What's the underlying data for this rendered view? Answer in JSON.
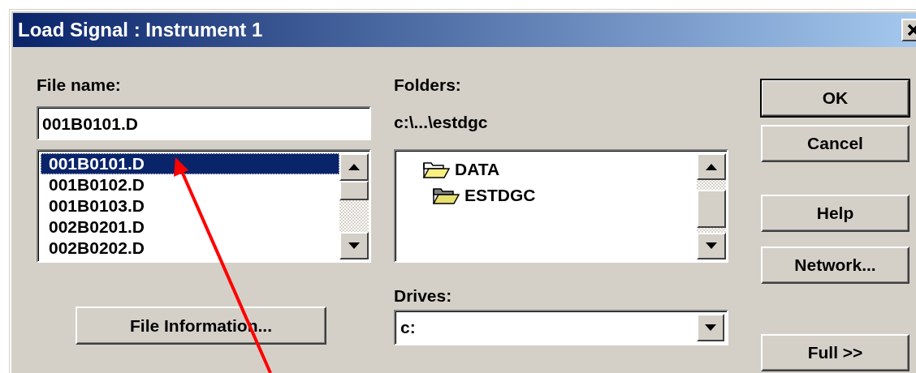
{
  "window": {
    "title": "Load Signal : Instrument 1"
  },
  "file_name": {
    "label": "File name:",
    "value": "001B0101.D"
  },
  "files": [
    {
      "name": "001B0101.D",
      "selected": true
    },
    {
      "name": "001B0102.D",
      "selected": false
    },
    {
      "name": "001B0103.D",
      "selected": false
    },
    {
      "name": "002B0201.D",
      "selected": false
    },
    {
      "name": "002B0202.D",
      "selected": false
    }
  ],
  "file_info_button": "File Information...",
  "folders": {
    "label": "Folders:",
    "path": "c:\\...\\estdgc",
    "tree": [
      {
        "name": "DATA",
        "children": [
          {
            "name": "ESTDGC"
          }
        ]
      }
    ]
  },
  "drives": {
    "label": "Drives:",
    "value": "c:"
  },
  "buttons": [
    {
      "label": "OK",
      "kind": "default"
    },
    {
      "label": "Cancel",
      "kind": "normal"
    },
    {
      "label": "Help",
      "kind": "normal"
    },
    {
      "label": "Network...",
      "kind": "normal"
    },
    {
      "label": "Full >>",
      "kind": "normal"
    }
  ],
  "annotation": {
    "kind": "arrow"
  }
}
